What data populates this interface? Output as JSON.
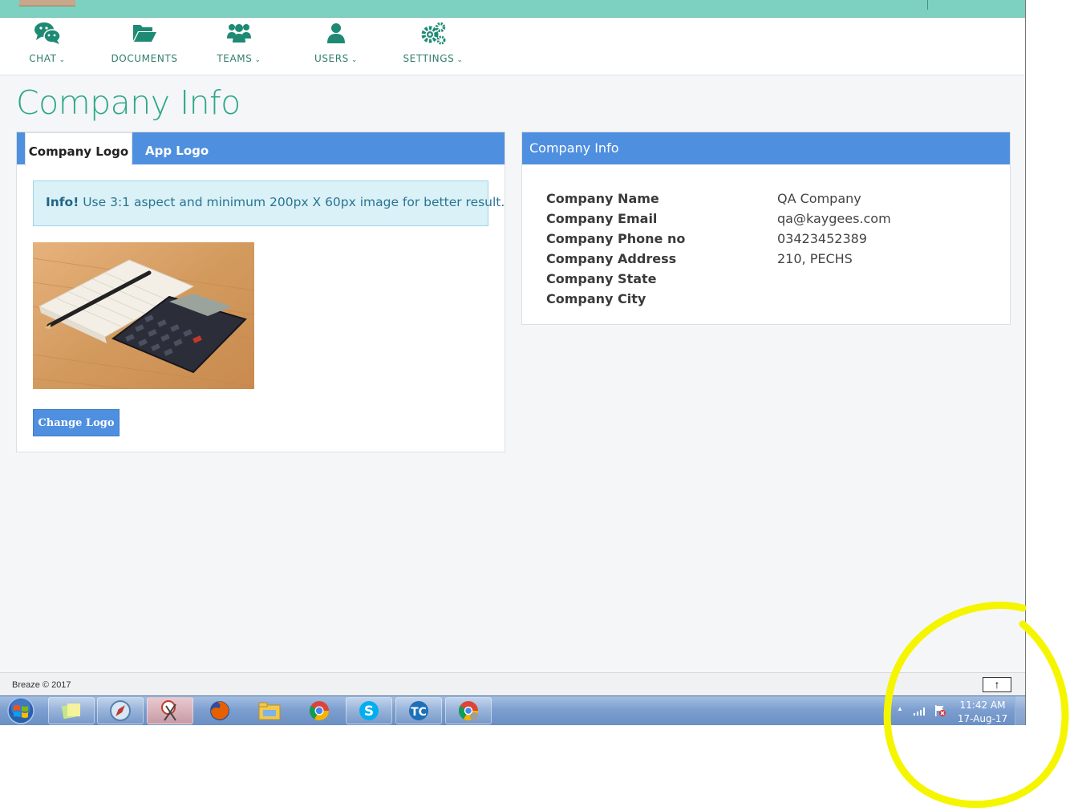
{
  "nav": {
    "items": [
      {
        "label": "CHAT",
        "icon": "chat-icon",
        "dropdown": true
      },
      {
        "label": "DOCUMENTS",
        "icon": "folder-open-icon",
        "dropdown": false
      },
      {
        "label": "TEAMS",
        "icon": "users-group-icon",
        "dropdown": true
      },
      {
        "label": "USERS",
        "icon": "user-icon",
        "dropdown": true
      },
      {
        "label": "SETTINGS",
        "icon": "gears-icon",
        "dropdown": true
      }
    ],
    "chevron": "⌄"
  },
  "page": {
    "title": "Company Info"
  },
  "logo_panel": {
    "tabs": {
      "company_logo": "Company Logo",
      "app_logo": "App Logo"
    },
    "info_strong": "Info!",
    "info_text": " Use 3:1 aspect and minimum 200px X 60px image for better result.",
    "change_button": "Change Logo"
  },
  "info_panel": {
    "header": "Company Info",
    "rows": [
      {
        "label": "Company Name",
        "value": "QA Company"
      },
      {
        "label": "Company Email",
        "value": "qa@kaygees.com"
      },
      {
        "label": "Company Phone no",
        "value": "03423452389"
      },
      {
        "label": "Company Address",
        "value": "210, PECHS"
      },
      {
        "label": "Company State",
        "value": ""
      },
      {
        "label": "Company City",
        "value": ""
      }
    ]
  },
  "footer": {
    "text": "Breaze © 2017",
    "scroll_top_icon": "↑"
  },
  "taskbar": {
    "time": "11:42 AM",
    "date": "17-Aug-17",
    "tray_expand": "▲",
    "apps": [
      "sticky-notes-icon",
      "safari-icon",
      "snipping-tool-icon",
      "firefox-icon",
      "file-explorer-icon",
      "chrome-icon",
      "skype-icon",
      "teamcity-icon",
      "chrome-canary-icon"
    ]
  },
  "colors": {
    "accent_teal": "#2ea888",
    "header_blue": "#4f8fdf",
    "annotation_yellow": "#f5f500"
  }
}
